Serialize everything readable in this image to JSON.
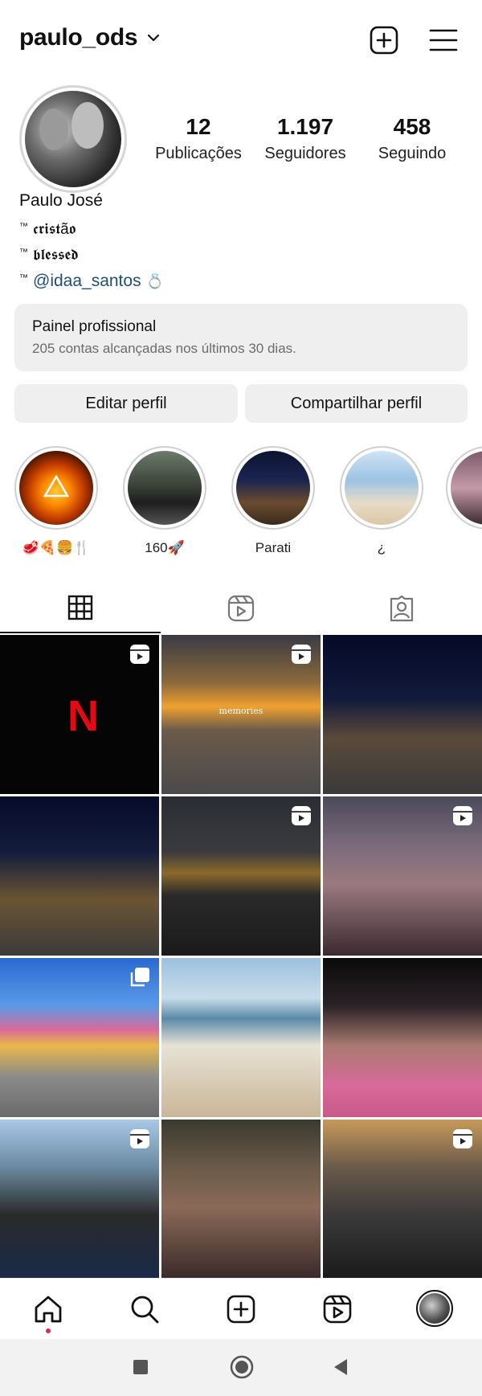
{
  "header": {
    "username": "paulo_ods",
    "icons": [
      "chevron-down-icon",
      "new-post-icon",
      "menu-icon"
    ]
  },
  "profile": {
    "posts_count": "12",
    "posts_label": "Publicações",
    "followers_count": "1.197",
    "followers_label": "Seguidores",
    "following_count": "458",
    "following_label": "Seguindo",
    "name": "Paulo José",
    "bio_line1_prefix": "™",
    "bio_line1": "𝖈𝖗𝖎𝖘𝖙ã𝖔",
    "bio_line2_prefix": "™",
    "bio_line2": "𝖇𝖑𝖊𝖘𝖘𝖊𝖉",
    "bio_line3_prefix": "™",
    "bio_mention": "@idaa_santos",
    "bio_emoji": "💍"
  },
  "panel": {
    "title": "Painel profissional",
    "subtitle": "205 contas alcançadas nos últimos 30 dias."
  },
  "buttons": {
    "edit": "Editar perfil",
    "share": "Compartilhar perfil"
  },
  "highlights": [
    {
      "label": "🥩🍕🍔🍴"
    },
    {
      "label": "160🚀"
    },
    {
      "label": "Parati"
    },
    {
      "label": "¿"
    },
    {
      "label": ""
    }
  ],
  "tabs": [
    "grid-icon",
    "reels-icon",
    "tagged-icon"
  ],
  "grid_overlays": {
    "memories_text": "memories",
    "netflix_letter": "N"
  },
  "colors": {
    "accent_link": "#1f4e79",
    "notification_dot": "#e0245e",
    "panel_bg": "#efefef",
    "netflix_red": "#e50914"
  }
}
